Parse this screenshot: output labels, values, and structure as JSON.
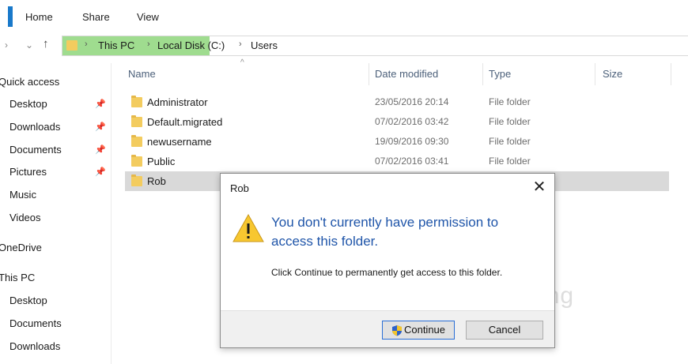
{
  "ribbon": {
    "tabs": [
      "Home",
      "Share",
      "View"
    ]
  },
  "nav": {
    "back": "›",
    "recent": "⌄",
    "up": "↑"
  },
  "address": {
    "crumbs": [
      "This PC",
      "Local Disk (C:)",
      "Users"
    ],
    "separator": "›"
  },
  "sidebar": {
    "quick_access": "Quick access",
    "quick_items": [
      "Desktop",
      "Downloads",
      "Documents",
      "Pictures",
      "Music",
      "Videos"
    ],
    "onedrive": "OneDrive",
    "this_pc": "This PC",
    "pc_items": [
      "Desktop",
      "Documents",
      "Downloads"
    ],
    "pin_glyph": "📌"
  },
  "columns": {
    "name": "Name",
    "date": "Date modified",
    "type": "Type",
    "size": "Size",
    "sort_arrow": "^"
  },
  "rows": [
    {
      "name": "Administrator",
      "date": "23/05/2016 20:14",
      "type": "File folder"
    },
    {
      "name": "Default.migrated",
      "date": "07/02/2016 03:42",
      "type": "File folder"
    },
    {
      "name": "newusername",
      "date": "19/09/2016 09:30",
      "type": "File folder"
    },
    {
      "name": "Public",
      "date": "07/02/2016 03:41",
      "type": "File folder"
    },
    {
      "name": "Rob",
      "date": "",
      "type": ""
    }
  ],
  "dialog": {
    "title": "Rob",
    "close": "✕",
    "main_message": "You don't currently have permission to access this folder.",
    "sub_message": "Click Continue to permanently get access to this folder.",
    "continue_label": "Continue",
    "cancel_label": "Cancel"
  },
  "watermark": "uantrimang",
  "colors": {
    "accent": "#1979ca",
    "address_highlight": "#9fdc8f",
    "folder": "#f3cc5f",
    "dialog_text": "#1f55a9"
  }
}
